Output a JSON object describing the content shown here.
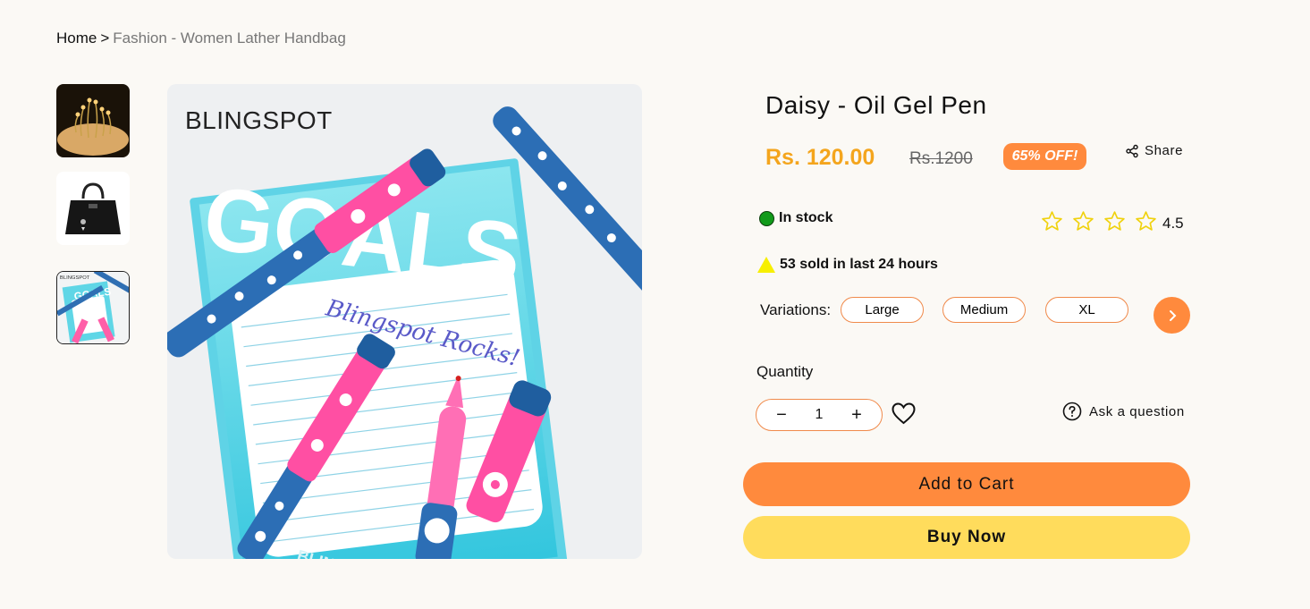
{
  "breadcrumb": {
    "home": "Home",
    "separator": ">",
    "current": "Fashion - Women Lather Handbag"
  },
  "gallery": {
    "thumbnails": [
      {
        "icon": "birthday-candles-image"
      },
      {
        "icon": "black-handbag-image"
      },
      {
        "icon": "gel-pens-notepad-image",
        "active": true
      }
    ],
    "main_image": {
      "brand": "BLINGSPOT",
      "notepad_heading": "GOALS",
      "handwriting": "Blingspot Rocks!",
      "notepad_footer": "BLINGSPOT"
    }
  },
  "product": {
    "title": "Daisy - Oil Gel Pen",
    "price": "Rs. 120.00",
    "old_price": "Rs.1200",
    "discount": "65% OFF!",
    "share_label": "Share",
    "stock_status": "In stock",
    "rating_stars": 4,
    "rating_value": "4.5",
    "sold_text": "53 sold in last 24 hours",
    "variations_label": "Variations:",
    "variations": [
      "Large",
      "Medium",
      "XL"
    ],
    "quantity_label": "Quantity",
    "quantity_value": "1",
    "ask_label": "Ask a question",
    "add_to_cart": "Add to Cart",
    "buy_now": "Buy Now"
  },
  "colors": {
    "accent_orange": "#ff8a3d",
    "price_gold": "#f4a51d",
    "buy_yellow": "#ffdc5c",
    "in_stock_green": "#119a1a",
    "background": "#fbf9f5"
  }
}
